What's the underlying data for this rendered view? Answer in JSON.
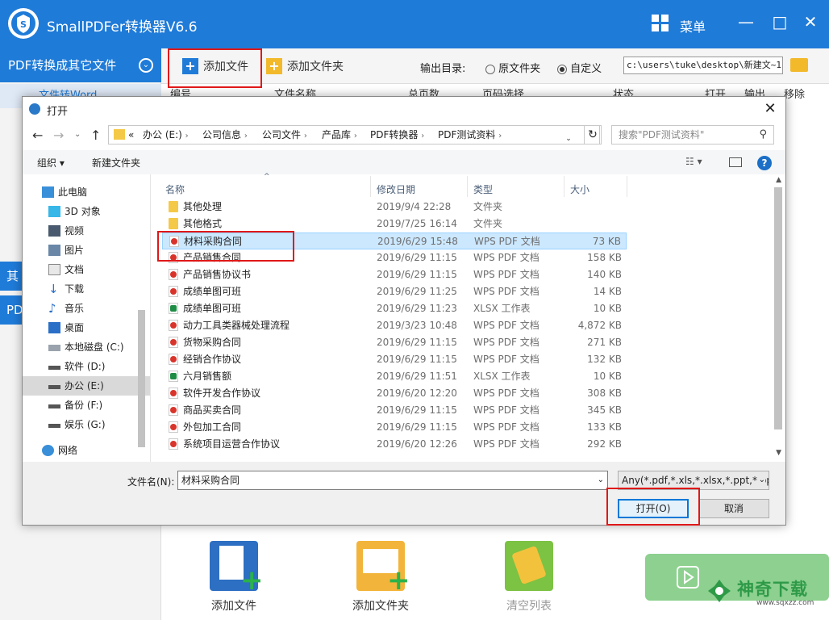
{
  "app": {
    "title": "SmallPDFer转换器V6.6",
    "menu_label": "菜单",
    "minimize": "—",
    "maximize": "□",
    "close": "✕"
  },
  "sidebar": {
    "header": "PDF转换成其它文件",
    "sub_item": "文件转Word",
    "blue_items": [
      "其",
      "PDF"
    ]
  },
  "toolbar": {
    "add_file": "添加文件",
    "add_folder": "添加文件夹",
    "output_label": "输出目录:",
    "radio_original": "原文件夹",
    "radio_custom": "自定义",
    "output_path": "c:\\users\\tuke\\desktop\\新建文~1"
  },
  "columns": [
    "编号",
    "文件名称",
    "总页数",
    "页码选择",
    "状态",
    "打开",
    "输出",
    "移除"
  ],
  "bottom": {
    "add_file": "添加文件",
    "add_folder": "添加文件夹",
    "clear_list": "清空列表"
  },
  "watermark": {
    "name": "神奇下载",
    "url": "www.sqxzz.com"
  },
  "colors": {
    "brand_blue": "#1f7bd8",
    "highlight_red": "#e01818",
    "selection_blue": "#cce8ff"
  },
  "dialog": {
    "title": "打开",
    "breadcrumbs": [
      "«",
      "办公 (E:)",
      "公司信息",
      "公司文件",
      "产品库",
      "PDF转换器",
      "PDF测试资料"
    ],
    "search_placeholder": "搜索\"PDF测试资料\"",
    "organize": "组织 ▾",
    "new_folder": "新建文件夹",
    "nav_items": [
      {
        "label": "此电脑",
        "icon": "computer-icon"
      },
      {
        "label": "3D 对象",
        "icon": "3d-objects-icon"
      },
      {
        "label": "视频",
        "icon": "video-icon"
      },
      {
        "label": "图片",
        "icon": "pictures-icon"
      },
      {
        "label": "文档",
        "icon": "documents-icon"
      },
      {
        "label": "下载",
        "icon": "download-icon"
      },
      {
        "label": "音乐",
        "icon": "music-icon"
      },
      {
        "label": "桌面",
        "icon": "desktop-icon"
      },
      {
        "label": "本地磁盘 (C:)",
        "icon": "drive-icon"
      },
      {
        "label": "软件 (D:)",
        "icon": "drive-icon"
      },
      {
        "label": "办公 (E:)",
        "icon": "drive-icon"
      },
      {
        "label": "备份 (F:)",
        "icon": "drive-icon"
      },
      {
        "label": "娱乐 (G:)",
        "icon": "drive-icon"
      },
      {
        "label": "网络",
        "icon": "network-icon"
      }
    ],
    "file_columns": [
      "名称",
      "修改日期",
      "类型",
      "大小"
    ],
    "files": [
      {
        "name": "其他处理",
        "date": "2019/9/4 22:28",
        "type": "文件夹",
        "size": "",
        "kind": "folder"
      },
      {
        "name": "其他格式",
        "date": "2019/7/25 16:14",
        "type": "文件夹",
        "size": "",
        "kind": "folder"
      },
      {
        "name": "材料采购合同",
        "date": "2019/6/29 15:48",
        "type": "WPS PDF 文档",
        "size": "73 KB",
        "kind": "pdf"
      },
      {
        "name": "产品销售合同",
        "date": "2019/6/29 11:15",
        "type": "WPS PDF 文档",
        "size": "158 KB",
        "kind": "pdf"
      },
      {
        "name": "产品销售协议书",
        "date": "2019/6/29 11:15",
        "type": "WPS PDF 文档",
        "size": "140 KB",
        "kind": "pdf"
      },
      {
        "name": "成绩单图可班",
        "date": "2019/6/29 11:25",
        "type": "WPS PDF 文档",
        "size": "14 KB",
        "kind": "pdf"
      },
      {
        "name": "成绩单图可班",
        "date": "2019/6/29 11:23",
        "type": "XLSX 工作表",
        "size": "10 KB",
        "kind": "xlsx"
      },
      {
        "name": "动力工具类器械处理流程",
        "date": "2019/3/23 10:48",
        "type": "WPS PDF 文档",
        "size": "4,872 KB",
        "kind": "pdf"
      },
      {
        "name": "货物采购合同",
        "date": "2019/6/29 11:15",
        "type": "WPS PDF 文档",
        "size": "271 KB",
        "kind": "pdf"
      },
      {
        "name": "经销合作协议",
        "date": "2019/6/29 11:15",
        "type": "WPS PDF 文档",
        "size": "132 KB",
        "kind": "pdf"
      },
      {
        "name": "六月销售额",
        "date": "2019/6/29 11:51",
        "type": "XLSX 工作表",
        "size": "10 KB",
        "kind": "xlsx"
      },
      {
        "name": "软件开发合作协议",
        "date": "2019/6/20 12:20",
        "type": "WPS PDF 文档",
        "size": "308 KB",
        "kind": "pdf"
      },
      {
        "name": "商品买卖合同",
        "date": "2019/6/29 11:15",
        "type": "WPS PDF 文档",
        "size": "345 KB",
        "kind": "pdf"
      },
      {
        "name": "外包加工合同",
        "date": "2019/6/29 11:15",
        "type": "WPS PDF 文档",
        "size": "133 KB",
        "kind": "pdf"
      },
      {
        "name": "系统项目运营合作协议",
        "date": "2019/6/20 12:26",
        "type": "WPS PDF 文档",
        "size": "292 KB",
        "kind": "pdf"
      }
    ],
    "selected_index": 2,
    "filename_label": "文件名(N):",
    "filename_value": "材料采购合同",
    "filetype_value": "Any(*.pdf,*.xls,*.xlsx,*.ppt,*.pp",
    "open_button": "打开(O)",
    "cancel_button": "取消"
  }
}
